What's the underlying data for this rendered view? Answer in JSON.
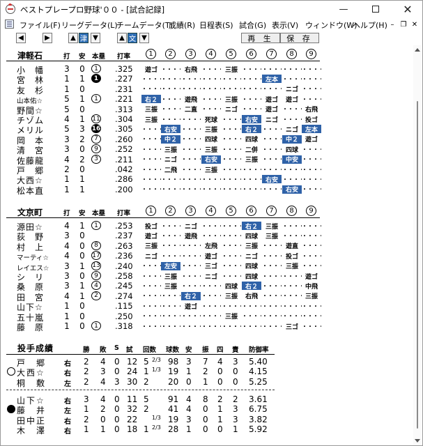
{
  "window": {
    "title": "ベストプレープロ野球'００ - [試合記録]"
  },
  "menu": [
    "ファイル(F)",
    "リーグデータ(L)",
    "チームデータ(T)",
    "成績(R)",
    "日程表(S)",
    "試合(G)",
    "表示(V)",
    "ウィンドウ(W)",
    "ヘルプ(H)"
  ],
  "toolbar": {
    "team1": "津",
    "team2": "文",
    "replay": "再 生",
    "save": "保 存"
  },
  "colors": {
    "hit_bg": "#2f62a8"
  },
  "columns": {
    "ab": "打",
    "hits": "安",
    "hr": "本塁",
    "avg": "打率"
  },
  "innings": [
    "1",
    "2",
    "3",
    "4",
    "5",
    "6",
    "7",
    "8",
    "9"
  ],
  "away": {
    "team": "津軽石",
    "players": [
      {
        "name": "小　幡",
        "ab": "3",
        "h": "0",
        "hr": "1",
        "hr_fill": false,
        "avg": ".325",
        "res": [
          "遊ゴ",
          "",
          "右飛",
          "",
          "三振",
          "",
          "",
          "",
          ""
        ]
      },
      {
        "name": "宮　林",
        "ab": "1",
        "h": "1",
        "hr": "1",
        "hr_fill": true,
        "avg": ".227",
        "res": [
          "",
          "",
          "",
          "",
          "",
          "",
          "左本",
          "",
          ""
        ]
      },
      {
        "name": "友　杉",
        "ab": "1",
        "h": "0",
        "hr": "",
        "hr_fill": false,
        "avg": ".231",
        "res": [
          "",
          "",
          "",
          "",
          "",
          "",
          "",
          "ニゴ",
          ""
        ]
      },
      {
        "name": "山本佑☆",
        "small": true,
        "ab": "5",
        "h": "1",
        "hr": "1",
        "hr_fill": false,
        "avg": ".221",
        "res": [
          "右２",
          "",
          "遊飛",
          "",
          "三振",
          "",
          "遊ゴ",
          "遊ゴ",
          ""
        ]
      },
      {
        "name": "野間☆",
        "ab": "5",
        "h": "0",
        "hr": "",
        "hr_fill": false,
        "avg": ".313",
        "res": [
          "三振",
          "",
          "二直",
          "",
          "ニゴ",
          "",
          "遊ゴ",
          "",
          "右飛"
        ]
      },
      {
        "name": "チゾム",
        "ab": "4",
        "h": "1",
        "hr": "11",
        "hr_fill": false,
        "avg": ".304",
        "res": [
          "三振",
          "",
          "",
          "死球",
          "",
          "右安",
          "ニゴ",
          "",
          "投ゴ"
        ]
      },
      {
        "name": "メリル",
        "ab": "5",
        "h": "3",
        "hr": "16",
        "hr_fill": true,
        "avg": ".305",
        "res": [
          "",
          "右安",
          "",
          "三振",
          "",
          "右２",
          "",
          "ニゴ",
          "左本"
        ]
      },
      {
        "name": "岡　本",
        "ab": "3",
        "h": "2",
        "hr": "7",
        "hr_fill": false,
        "avg": ".260",
        "res": [
          "",
          "中２",
          "",
          "四球",
          "",
          "四球",
          "",
          "中２",
          "遊ゴ"
        ]
      },
      {
        "name": "清　宮",
        "ab": "3",
        "h": "0",
        "hr": "9",
        "hr_fill": false,
        "avg": ".252",
        "res": [
          "",
          "三振",
          "",
          "三振",
          "",
          "二併",
          "",
          "四球",
          ""
        ]
      },
      {
        "name": "佐藤龍",
        "ab": "4",
        "h": "2",
        "hr": "3",
        "hr_fill": false,
        "avg": ".211",
        "res": [
          "",
          "ニゴ",
          "",
          "右安",
          "",
          "三振",
          "",
          "中安",
          ""
        ]
      },
      {
        "name": "戸　郷",
        "ab": "2",
        "h": "0",
        "hr": "",
        "hr_fill": false,
        "avg": ".042",
        "res": [
          "",
          "二飛",
          "",
          "三振",
          "",
          "",
          "",
          "",
          ""
        ]
      },
      {
        "name": "大西☆",
        "ab": "1",
        "h": "1",
        "hr": "",
        "hr_fill": false,
        "avg": ".286",
        "res": [
          "",
          "",
          "",
          "",
          "",
          "",
          "右安",
          "",
          ""
        ]
      },
      {
        "name": "松本直",
        "ab": "1",
        "h": "1",
        "hr": "",
        "hr_fill": false,
        "avg": ".200",
        "res": [
          "",
          "",
          "",
          "",
          "",
          "",
          "",
          "右安",
          ""
        ]
      }
    ]
  },
  "home": {
    "team": "文京町",
    "players": [
      {
        "name": "源田☆",
        "ab": "4",
        "h": "1",
        "hr": "1",
        "hr_fill": false,
        "avg": ".253",
        "res": [
          "投ゴ",
          "",
          "ニゴ",
          "",
          "",
          "右２",
          "三振",
          "",
          ""
        ]
      },
      {
        "name": "荻　野",
        "ab": "3",
        "h": "0",
        "hr": "",
        "hr_fill": false,
        "avg": ".237",
        "res": [
          "遊ゴ",
          "",
          "遊飛",
          "",
          "",
          "四球",
          "三振",
          "",
          ""
        ]
      },
      {
        "name": "村　上",
        "ab": "4",
        "h": "0",
        "hr": "8",
        "hr_fill": false,
        "avg": ".263",
        "res": [
          "三振",
          "",
          "",
          "左飛",
          "",
          "三振",
          "",
          "遊直",
          ""
        ]
      },
      {
        "name": "マーティ☆",
        "small": true,
        "ab": "4",
        "h": "0",
        "hr": "17",
        "hr_fill": false,
        "avg": ".236",
        "res": [
          "ニゴ",
          "",
          "",
          "遊ゴ",
          "",
          "ニゴ",
          "",
          "投ゴ",
          ""
        ]
      },
      {
        "name": "レイエス☆",
        "small": true,
        "ab": "3",
        "h": "1",
        "hr": "13",
        "hr_fill": false,
        "avg": ".240",
        "res": [
          "",
          "左安",
          "",
          "三ゴ",
          "",
          "四球",
          "",
          "三振",
          ""
        ]
      },
      {
        "name": "シ　リ",
        "ab": "3",
        "h": "0",
        "hr": "9",
        "hr_fill": false,
        "avg": ".258",
        "res": [
          "",
          "三振",
          "",
          "ニゴ",
          "",
          "四球",
          "",
          "",
          "遊ゴ"
        ]
      },
      {
        "name": "桑　原",
        "ab": "3",
        "h": "1",
        "hr": "4",
        "hr_fill": false,
        "avg": ".245",
        "res": [
          "",
          "三振",
          "",
          "",
          "四球",
          "右２",
          "",
          "",
          "中飛"
        ]
      },
      {
        "name": "田　宮",
        "ab": "4",
        "h": "1",
        "hr": "2",
        "hr_fill": false,
        "avg": ".274",
        "res": [
          "",
          "",
          "右２",
          "",
          "三振",
          "右飛",
          "",
          "",
          "三振"
        ]
      },
      {
        "name": "山下☆",
        "ab": "1",
        "h": "0",
        "hr": "",
        "hr_fill": false,
        "avg": ".115",
        "res": [
          "",
          "",
          "遊ゴ",
          "",
          "",
          "",
          "",
          "",
          ""
        ]
      },
      {
        "name": "五十嵐",
        "ab": "1",
        "h": "0",
        "hr": "",
        "hr_fill": false,
        "avg": ".250",
        "res": [
          "",
          "",
          "",
          "",
          "三振",
          "",
          "",
          "",
          ""
        ]
      },
      {
        "name": "藤　原",
        "ab": "1",
        "h": "0",
        "hr": "1",
        "hr_fill": false,
        "avg": ".318",
        "res": [
          "",
          "",
          "",
          "",
          "",
          "",
          "",
          "三ゴ",
          ""
        ]
      }
    ]
  },
  "pitching": {
    "title": "投手成績",
    "headers": [
      "勝",
      "敗",
      "S",
      "試",
      "回数",
      "球数",
      "安",
      "振",
      "四",
      "責",
      "防御率"
    ],
    "away": [
      {
        "mark": "",
        "name": "戸　郷",
        "hand": "右",
        "w": "2",
        "l": "4",
        "s": "0",
        "g": "12",
        "ip": "5",
        "ip_frac": "2/3",
        "pc": "98",
        "h": "3",
        "k": "7",
        "bb": "4",
        "er": "3",
        "era": "5.40"
      },
      {
        "mark": "win",
        "name": "大西☆",
        "hand": "右",
        "w": "2",
        "l": "3",
        "s": "0",
        "g": "24",
        "ip": "1",
        "ip_frac": "1/3",
        "pc": "19",
        "h": "1",
        "k": "2",
        "bb": "0",
        "er": "0",
        "era": "4.15"
      },
      {
        "mark": "",
        "name": "桐　敷",
        "hand": "左",
        "w": "2",
        "l": "4",
        "s": "3",
        "g": "30",
        "ip": "2",
        "ip_frac": "",
        "pc": "20",
        "h": "0",
        "k": "1",
        "bb": "0",
        "er": "0",
        "era": "5.25"
      }
    ],
    "home": [
      {
        "mark": "",
        "name": "山下☆",
        "hand": "右",
        "w": "3",
        "l": "4",
        "s": "0",
        "g": "11",
        "ip": "5",
        "ip_frac": "",
        "pc": "91",
        "h": "4",
        "k": "8",
        "bb": "2",
        "er": "2",
        "era": "3.61"
      },
      {
        "mark": "lose",
        "name": "藤　井",
        "hand": "左",
        "w": "1",
        "l": "2",
        "s": "0",
        "g": "32",
        "ip": "2",
        "ip_frac": "",
        "pc": "41",
        "h": "4",
        "k": "0",
        "bb": "1",
        "er": "3",
        "era": "6.75"
      },
      {
        "mark": "",
        "name": "田中正",
        "hand": "右",
        "w": "2",
        "l": "0",
        "s": "0",
        "g": "22",
        "ip": "",
        "ip_frac": "1/3",
        "pc": "19",
        "h": "3",
        "k": "0",
        "bb": "1",
        "er": "3",
        "era": "3.82"
      },
      {
        "mark": "",
        "name": "木　澤",
        "hand": "右",
        "w": "1",
        "l": "1",
        "s": "0",
        "g": "18",
        "ip": "1",
        "ip_frac": "2/3",
        "pc": "28",
        "h": "1",
        "k": "0",
        "bb": "0",
        "er": "1",
        "era": "5.92"
      }
    ]
  }
}
